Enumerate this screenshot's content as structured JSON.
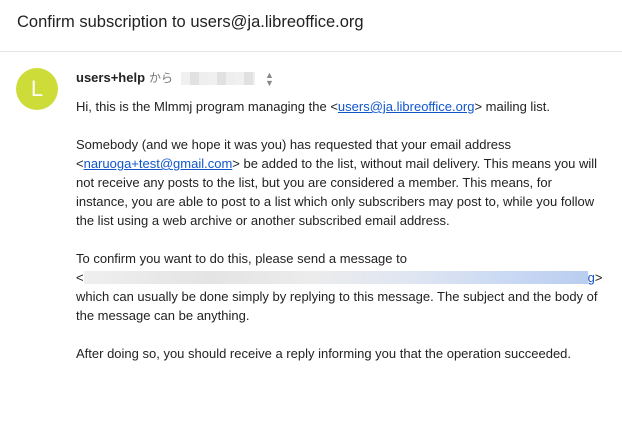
{
  "subject": "Confirm subscription to users@ja.libreoffice.org",
  "sender": {
    "avatar_letter": "L",
    "avatar_color": "#cddc39",
    "name": "users+help",
    "from_label": "から"
  },
  "body": {
    "p1": {
      "prefix": "Hi, this is the Mlmmj program managing the <",
      "link": "users@ja.libreoffice.org",
      "suffix": "> mailing list."
    },
    "p2": {
      "prefix": "Somebody (and we hope it was you) has requested that your email address <",
      "link": "naruoga+test@gmail.com",
      "suffix": "> be added to the list, without mail delivery. This means you will not receive any posts to the list, but you are considered a member. This means, for instance, you are able to post to a list which only subscribers may post to, while you follow the list using a web archive or another subscribed email address."
    },
    "p3": {
      "line1": "To confirm you want to do this, please send a message to",
      "open": "<",
      "link_tail": "g",
      "close": ">",
      "rest": "which can usually be done simply by replying to this message. The subject and the body of the message can be anything."
    },
    "p4": "After doing so, you should receive a reply informing you that the operation succeeded."
  }
}
